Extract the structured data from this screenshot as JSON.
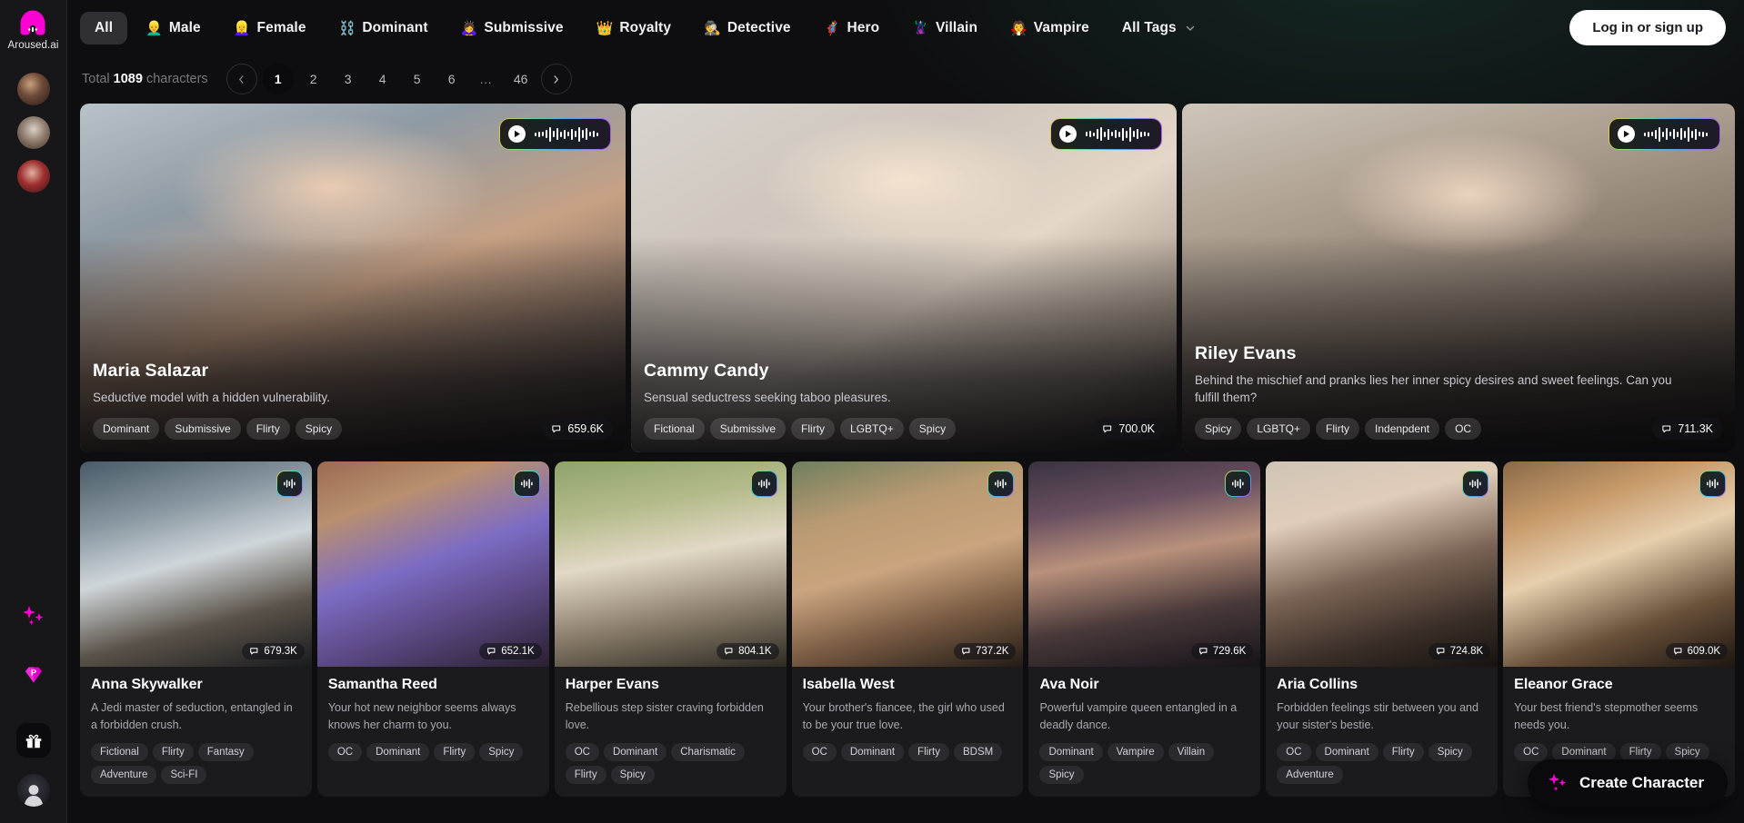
{
  "brand": {
    "name": "Aroused.ai",
    "logo_icon": "aroused-logo-icon"
  },
  "rail": {
    "avatars": [
      {
        "name": "rail-avatar-1"
      },
      {
        "name": "rail-avatar-2"
      },
      {
        "name": "rail-avatar-3"
      }
    ],
    "icons": [
      {
        "name": "sparkles-icon"
      },
      {
        "name": "premium-diamond-icon"
      },
      {
        "name": "gift-icon"
      },
      {
        "name": "profile-avatar-icon"
      }
    ]
  },
  "topnav": {
    "items": [
      {
        "label": "All",
        "emoji": "",
        "active": true
      },
      {
        "label": "Male",
        "emoji": "👱‍♂️",
        "active": false
      },
      {
        "label": "Female",
        "emoji": "👱‍♀️",
        "active": false
      },
      {
        "label": "Dominant",
        "emoji": "⛓️",
        "active": false
      },
      {
        "label": "Submissive",
        "emoji": "🙇‍♀️",
        "active": false
      },
      {
        "label": "Royalty",
        "emoji": "👑",
        "active": false
      },
      {
        "label": "Detective",
        "emoji": "🕵️",
        "active": false
      },
      {
        "label": "Hero",
        "emoji": "🦸‍♂️",
        "active": false
      },
      {
        "label": "Villain",
        "emoji": "🦹‍♀️",
        "active": false
      },
      {
        "label": "Vampire",
        "emoji": "🧛",
        "active": false
      }
    ],
    "all_tags_label": "All Tags",
    "login_label": "Log in or sign up"
  },
  "pagination": {
    "total_prefix": "Total",
    "total_count": "1089",
    "total_suffix": "characters",
    "prev_icon": "chevron-left-icon",
    "next_icon": "chevron-right-icon",
    "pages": [
      "1",
      "2",
      "3",
      "4",
      "5",
      "6",
      "…",
      "46"
    ],
    "current": "1"
  },
  "hero_cards": [
    {
      "name": "Maria Salazar",
      "description": "Seductive model with a hidden vulnerability.",
      "tags": [
        "Dominant",
        "Submissive",
        "Flirty",
        "Spicy"
      ],
      "views": "659.6K",
      "has_player": true,
      "photo_class": "p-maria"
    },
    {
      "name": "Cammy Candy",
      "description": "Sensual seductress seeking taboo pleasures.",
      "tags": [
        "Fictional",
        "Submissive",
        "Flirty",
        "LGBTQ+",
        "Spicy"
      ],
      "views": "700.0K",
      "has_player": true,
      "photo_class": "p-cammy"
    },
    {
      "name": "Riley Evans",
      "description": "Behind the mischief and pranks lies her inner spicy desires and sweet feelings. Can you fulfill them?",
      "tags": [
        "Spicy",
        "LGBTQ+",
        "Flirty",
        "Indenpdent",
        "OC"
      ],
      "views": "711.3K",
      "has_player": true,
      "photo_class": "p-riley"
    }
  ],
  "grid_cards": [
    {
      "name": "Anna Skywalker",
      "description": "A Jedi master of seduction, entangled in a forbidden crush.",
      "tags": [
        "Fictional",
        "Flirty",
        "Fantasy",
        "Adventure",
        "Sci-FI"
      ],
      "views": "679.3K",
      "photo_class": "p-anna"
    },
    {
      "name": "Samantha Reed",
      "description": "Your hot new neighbor seems always knows her charm to you.",
      "tags": [
        "OC",
        "Dominant",
        "Flirty",
        "Spicy"
      ],
      "views": "652.1K",
      "photo_class": "p-sam"
    },
    {
      "name": "Harper Evans",
      "description": "Rebellious step sister craving forbidden love.",
      "tags": [
        "OC",
        "Dominant",
        "Charismatic",
        "Flirty",
        "Spicy"
      ],
      "views": "804.1K",
      "photo_class": "p-harper"
    },
    {
      "name": "Isabella West",
      "description": "Your brother's fiancee, the girl who used to be your true love.",
      "tags": [
        "OC",
        "Dominant",
        "Flirty",
        "BDSM"
      ],
      "views": "737.2K",
      "photo_class": "p-isabella"
    },
    {
      "name": "Ava Noir",
      "description": "Powerful vampire queen entangled in a deadly dance.",
      "tags": [
        "Dominant",
        "Vampire",
        "Villain",
        "Spicy"
      ],
      "views": "729.6K",
      "photo_class": "p-ava"
    },
    {
      "name": "Aria Collins",
      "description": "Forbidden feelings stir between you and your sister's bestie.",
      "tags": [
        "OC",
        "Dominant",
        "Flirty",
        "Spicy",
        "Adventure"
      ],
      "views": "724.8K",
      "photo_class": "p-aria"
    },
    {
      "name": "Eleanor Grace",
      "description": "Your best friend's stepmother seems needs you.",
      "tags": [
        "OC",
        "Dominant",
        "Flirty",
        "Spicy"
      ],
      "views": "609.0K",
      "photo_class": "p-eleanor"
    }
  ],
  "fab": {
    "label": "Create Character",
    "icon": "sparkles-icon"
  },
  "colors": {
    "accent_pink": "#ff00d4",
    "page_bg": "#0e0e10",
    "rail_bg": "#17171a",
    "card_bg": "#1b1b1e",
    "login_bg": "#ffffff"
  }
}
